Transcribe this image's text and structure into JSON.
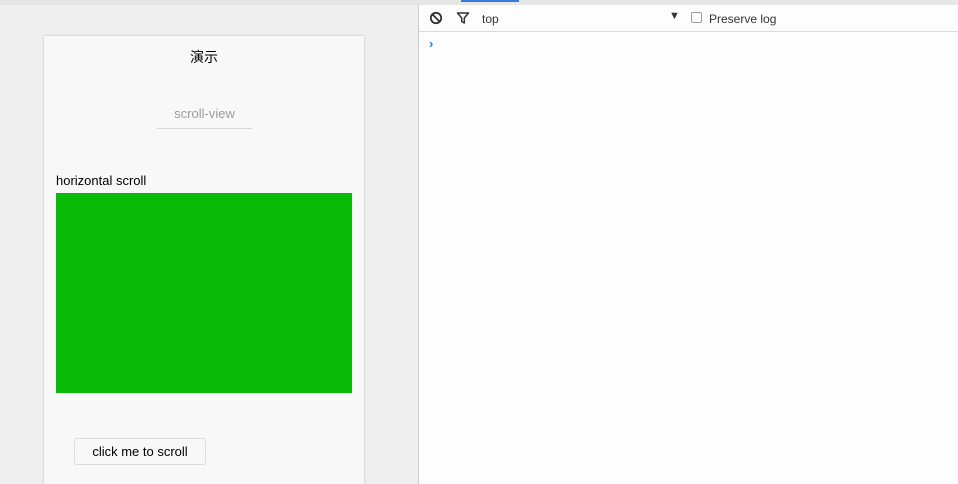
{
  "simulator": {
    "nav_title": "演示",
    "section_title": "scroll-view",
    "scroll_label": "horizontal scroll",
    "scroll_blocks": [
      {
        "color": "#09bb07"
      },
      {
        "color": "#ffd700"
      },
      {
        "color": "#f76260"
      }
    ],
    "button_label": "click me to scroll"
  },
  "console": {
    "clear_icon": "clear-console-icon",
    "filter_icon": "filter-icon",
    "context_value": "top",
    "dropdown_arrow": "▼",
    "preserve_log_label": "Preserve log",
    "preserve_log_checked": false,
    "prompt_symbol": "›"
  },
  "colors": {
    "accent": "#3879d9",
    "block_green": "#09bb07"
  }
}
